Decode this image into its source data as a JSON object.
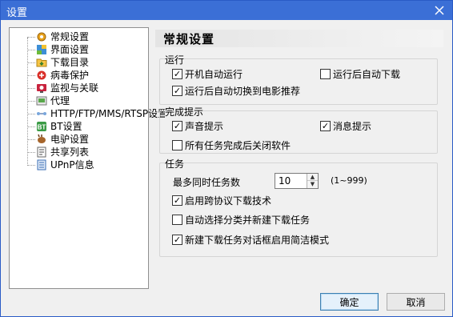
{
  "window": {
    "title": "设置"
  },
  "tree": {
    "items": [
      {
        "label": "常规设置",
        "icon": "gear-icon"
      },
      {
        "label": "界面设置",
        "icon": "palette-icon"
      },
      {
        "label": "下载目录",
        "icon": "folder-icon"
      },
      {
        "label": "病毒保护",
        "icon": "virus-shield-icon"
      },
      {
        "label": "监视与关联",
        "icon": "monitor-icon"
      },
      {
        "label": "代理",
        "icon": "proxy-icon"
      },
      {
        "label": "HTTP/FTP/MMS/RTSP设置",
        "icon": "network-icon"
      },
      {
        "label": "BT设置",
        "icon": "bt-icon"
      },
      {
        "label": "电驴设置",
        "icon": "donkey-icon"
      },
      {
        "label": "共享列表",
        "icon": "share-list-icon"
      },
      {
        "label": "UPnP信息",
        "icon": "upnp-icon"
      }
    ]
  },
  "panel": {
    "title": "常规设置",
    "run": {
      "label": "运行",
      "autostart": "开机自动运行",
      "autodownload": "运行后自动下载",
      "switch_movie": "运行后自动切换到电影推荐"
    },
    "complete": {
      "label": "完成提示",
      "sound": "声音提示",
      "message": "消息提示",
      "shutdown": "所有任务完成后关闭软件"
    },
    "tasks": {
      "label": "任务",
      "max_label": "最多同时任务数",
      "max_value": "10",
      "range": "(1~999)",
      "cross_protocol": "启用跨协议下载技术",
      "auto_category": "自动选择分类并新建下载任务",
      "simple_mode": "新建下载任务对话框启用简洁模式"
    }
  },
  "buttons": {
    "ok": "确定",
    "cancel": "取消"
  }
}
